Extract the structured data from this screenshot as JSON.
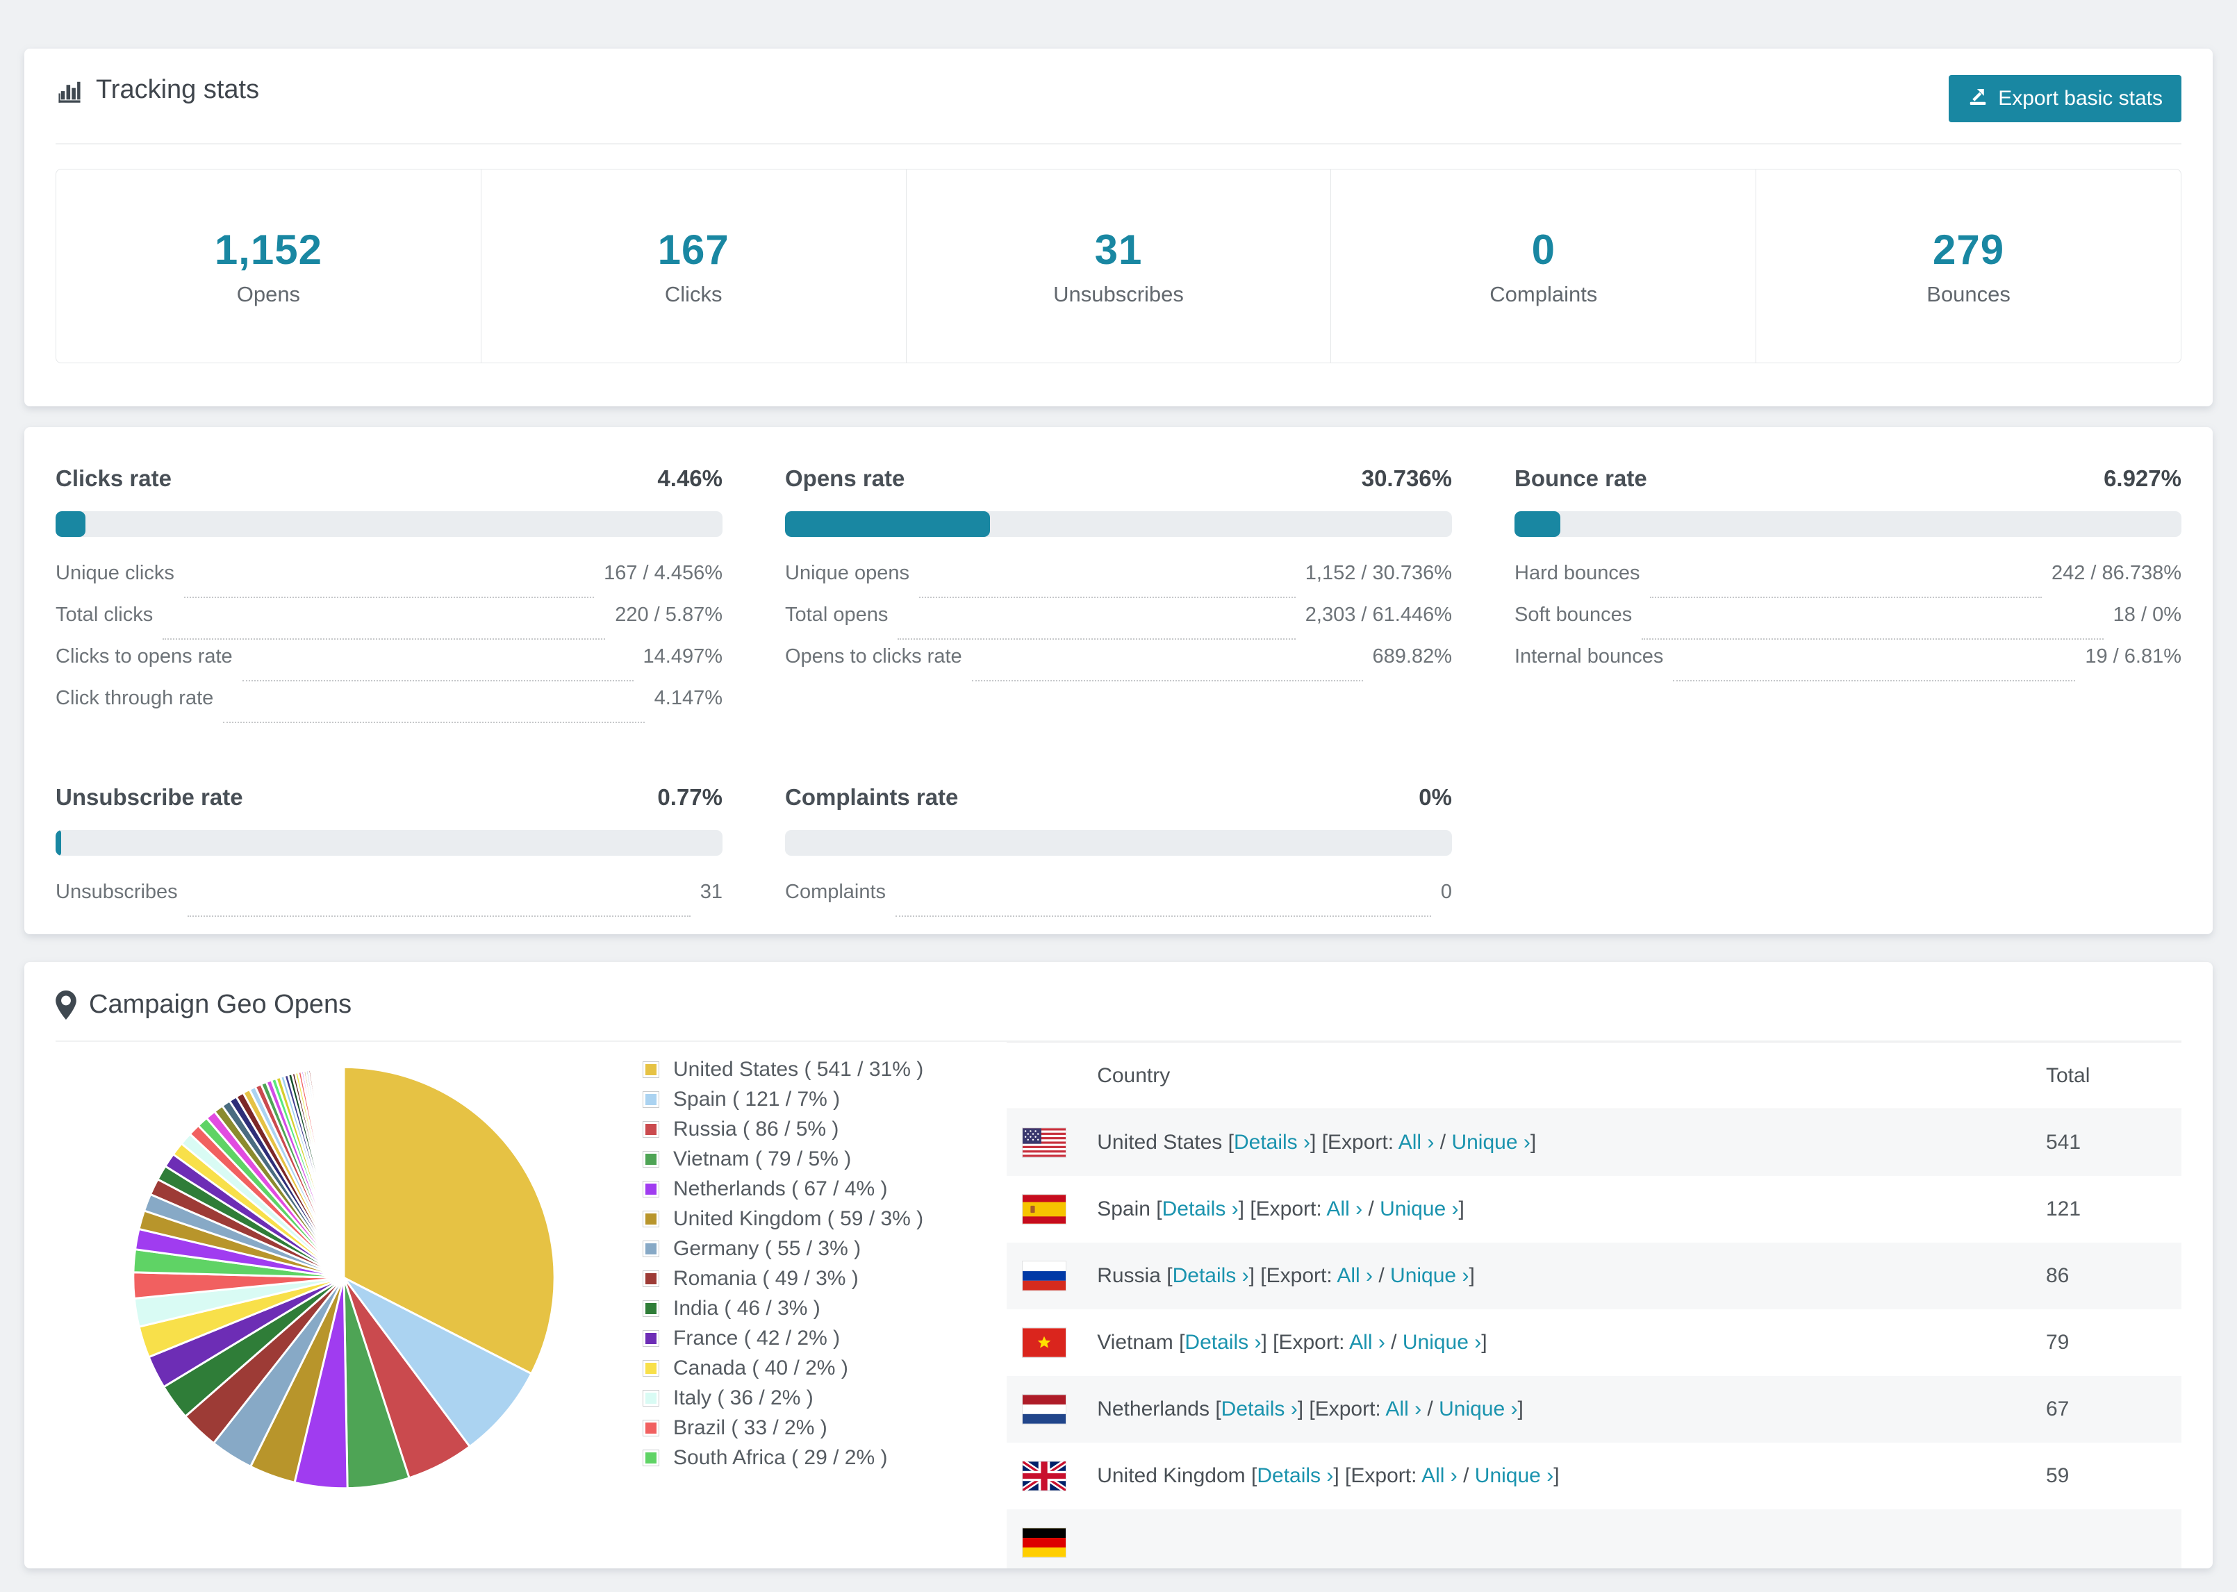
{
  "accent": "#1987a2",
  "tracking": {
    "title": "Tracking stats",
    "export_label": "Export basic stats",
    "stats": [
      {
        "value": "1,152",
        "label": "Opens"
      },
      {
        "value": "167",
        "label": "Clicks"
      },
      {
        "value": "31",
        "label": "Unsubscribes"
      },
      {
        "value": "0",
        "label": "Complaints"
      },
      {
        "value": "279",
        "label": "Bounces"
      }
    ]
  },
  "rates": [
    {
      "title": "Clicks rate",
      "value": "4.46%",
      "percent": 4.46,
      "rows": [
        {
          "label": "Unique clicks",
          "value": "167 / 4.456%"
        },
        {
          "label": "Total clicks",
          "value": "220 / 5.87%"
        },
        {
          "label": "Clicks to opens rate",
          "value": "14.497%"
        },
        {
          "label": "Click through rate",
          "value": "4.147%"
        }
      ]
    },
    {
      "title": "Opens rate",
      "value": "30.736%",
      "percent": 30.736,
      "rows": [
        {
          "label": "Unique opens",
          "value": "1,152 / 30.736%"
        },
        {
          "label": "Total opens",
          "value": "2,303 / 61.446%"
        },
        {
          "label": "Opens to clicks rate",
          "value": "689.82%"
        }
      ]
    },
    {
      "title": "Bounce rate",
      "value": "6.927%",
      "percent": 6.927,
      "rows": [
        {
          "label": "Hard bounces",
          "value": "242 / 86.738%"
        },
        {
          "label": "Soft bounces",
          "value": "18 / 0%"
        },
        {
          "label": "Internal bounces",
          "value": "19 / 6.81%"
        }
      ]
    },
    {
      "title": "Unsubscribe rate",
      "value": "0.77%",
      "percent": 0.77,
      "rows": [
        {
          "label": "Unsubscribes",
          "value": "31"
        }
      ]
    },
    {
      "title": "Complaints rate",
      "value": "0%",
      "percent": 0,
      "rows": [
        {
          "label": "Complaints",
          "value": "0"
        }
      ]
    }
  ],
  "geo": {
    "title": "Campaign Geo Opens",
    "table": {
      "country_header": "Country",
      "total_header": "Total",
      "details_label": "Details ›",
      "export_prefix": "[Export:",
      "all_label": "All ›",
      "unique_label": "Unique ›",
      "rows": [
        {
          "flag": "us",
          "country": "United States",
          "total": "541"
        },
        {
          "flag": "es",
          "country": "Spain",
          "total": "121"
        },
        {
          "flag": "ru",
          "country": "Russia",
          "total": "86"
        },
        {
          "flag": "vn",
          "country": "Vietnam",
          "total": "79"
        },
        {
          "flag": "nl",
          "country": "Netherlands",
          "total": "67"
        },
        {
          "flag": "gb",
          "country": "United Kingdom",
          "total": "59"
        },
        {
          "flag": "de",
          "country": "",
          "total": ""
        }
      ]
    }
  },
  "chart_data": {
    "type": "pie",
    "title": "Campaign Geo Opens",
    "legend_position": "right-of-chart",
    "labels": [
      "United States",
      "Spain",
      "Russia",
      "Vietnam",
      "Netherlands",
      "United Kingdom",
      "Germany",
      "Romania",
      "India",
      "France",
      "Canada",
      "Italy",
      "Brazil",
      "South Africa"
    ],
    "values": [
      541,
      121,
      86,
      79,
      67,
      59,
      55,
      49,
      46,
      42,
      40,
      36,
      33,
      29
    ],
    "percents": [
      "31%",
      "7%",
      "5%",
      "5%",
      "4%",
      "3%",
      "3%",
      "3%",
      "3%",
      "2%",
      "2%",
      "2%",
      "2%",
      "2%"
    ],
    "colors": [
      "#e6c244",
      "#abd3f1",
      "#ca4a4e",
      "#4ea455",
      "#a03cf0",
      "#b8952b",
      "#87a9c6",
      "#9d3b36",
      "#2f7d38",
      "#6d2db5",
      "#f8e04a",
      "#d9fbf4",
      "#f16060",
      "#5fd365"
    ],
    "others_tail_estimated": [
      26,
      24,
      22,
      21,
      19,
      18,
      17,
      16,
      15,
      14,
      13,
      12,
      11,
      10,
      10,
      9,
      8,
      8,
      7,
      7,
      6,
      6,
      5,
      5,
      5,
      4,
      4,
      4,
      3,
      3,
      3,
      3,
      2,
      2,
      2,
      2,
      2,
      2,
      1,
      1,
      1,
      1,
      1,
      1,
      1,
      1,
      1,
      1,
      1,
      1,
      1,
      1,
      1,
      1,
      1,
      1,
      1,
      1,
      1,
      1,
      1,
      1,
      1,
      1,
      1,
      1,
      1,
      1
    ],
    "tail_colors": [
      "#a03cf0",
      "#b8952b",
      "#87a9c6",
      "#9d3b36",
      "#2f7d38",
      "#6d2db5",
      "#f8e04a",
      "#d9fbf4",
      "#f16060",
      "#5fd365",
      "#e14ce0",
      "#8b8b2e",
      "#4a6c80",
      "#2e2e78",
      "#7c2828",
      "#e6c244",
      "#abd3f1",
      "#ca4a4e",
      "#4ea455",
      "#d24ce6",
      "#59e87c",
      "#d6ce2e",
      "#9ed0ef",
      "#413c8e",
      "#144d28",
      "#5c1f1f",
      "#e8e84a",
      "#f16060"
    ]
  }
}
